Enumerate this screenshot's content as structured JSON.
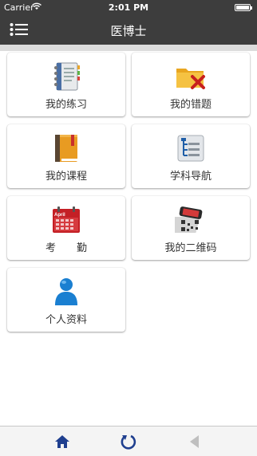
{
  "status_bar": {
    "carrier": "Carrier",
    "time": "2:01 PM"
  },
  "nav": {
    "title": "医博士",
    "menu_icon": "menu-icon"
  },
  "tiles": [
    {
      "label": "我的练习",
      "icon": "notebook-icon"
    },
    {
      "label": "我的错题",
      "icon": "folder-delete-icon"
    },
    {
      "label": "我的课程",
      "icon": "book-icon"
    },
    {
      "label": "学科导航",
      "icon": "tree-list-icon"
    },
    {
      "label": "考　　勤",
      "icon": "calendar-icon",
      "calendar_month": "April"
    },
    {
      "label": "我的二维码",
      "icon": "qr-code-phone-icon"
    },
    {
      "label": "个人资料",
      "icon": "person-icon"
    }
  ],
  "tab_bar": {
    "items": [
      "home-icon",
      "refresh-icon",
      "back-icon"
    ]
  },
  "colors": {
    "bar": "#3d3d3d",
    "tab_icon": "#1f3f8f"
  }
}
